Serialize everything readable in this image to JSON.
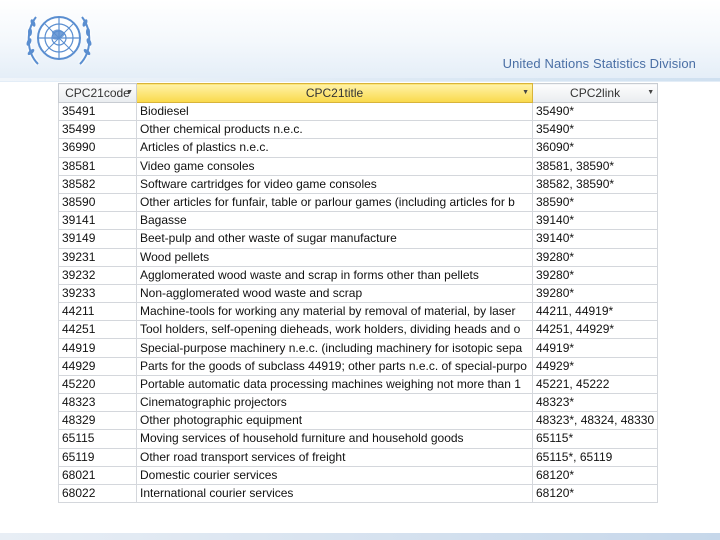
{
  "header": {
    "organization": "United Nations Statistics Division",
    "logo_name": "un-emblem"
  },
  "table": {
    "columns": [
      "CPC21code",
      "CPC21title",
      "CPC2link"
    ],
    "rows": [
      [
        "35491",
        "Biodiesel",
        "35490*"
      ],
      [
        "35499",
        "Other chemical products n.e.c.",
        "35490*"
      ],
      [
        "36990",
        "Articles of plastics n.e.c.",
        "36090*"
      ],
      [
        "38581",
        "Video game consoles",
        "38581, 38590*"
      ],
      [
        "38582",
        "Software cartridges for video game consoles",
        "38582, 38590*"
      ],
      [
        "38590",
        "Other articles for funfair, table or parlour games (including articles for b",
        "38590*"
      ],
      [
        "39141",
        "Bagasse",
        "39140*"
      ],
      [
        "39149",
        "Beet-pulp and other waste of sugar manufacture",
        "39140*"
      ],
      [
        "39231",
        "Wood pellets",
        "39280*"
      ],
      [
        "39232",
        "Agglomerated wood waste and scrap in forms other than pellets",
        "39280*"
      ],
      [
        "39233",
        "Non-agglomerated wood waste and scrap",
        "39280*"
      ],
      [
        "44211",
        "Machine-tools for working any material by removal of material, by laser",
        "44211, 44919*"
      ],
      [
        "44251",
        "Tool holders, self-opening dieheads, work holders, dividing heads and o",
        "44251, 44929*"
      ],
      [
        "44919",
        "Special-purpose machinery n.e.c. (including machinery for isotopic sepa",
        "44919*"
      ],
      [
        "44929",
        "Parts for the goods of subclass 44919; other parts n.e.c. of special-purpo",
        "44929*"
      ],
      [
        "45220",
        "Portable automatic data processing machines weighing not more than 1",
        "45221, 45222"
      ],
      [
        "48323",
        "Cinematographic projectors",
        "48323*"
      ],
      [
        "48329",
        "Other photographic equipment",
        "48323*, 48324, 48330"
      ],
      [
        "65115",
        "Moving services of household furniture and household goods",
        "65115*"
      ],
      [
        "65119",
        "Other road transport services of freight",
        "65115*, 65119"
      ],
      [
        "68021",
        "Domestic courier services",
        "68120*"
      ],
      [
        "68022",
        "International courier services",
        "68120*"
      ]
    ]
  },
  "colors": {
    "header_selected": "#f9d94a",
    "title_text": "#4a6fa5",
    "grid_line": "#d4d7dc"
  }
}
